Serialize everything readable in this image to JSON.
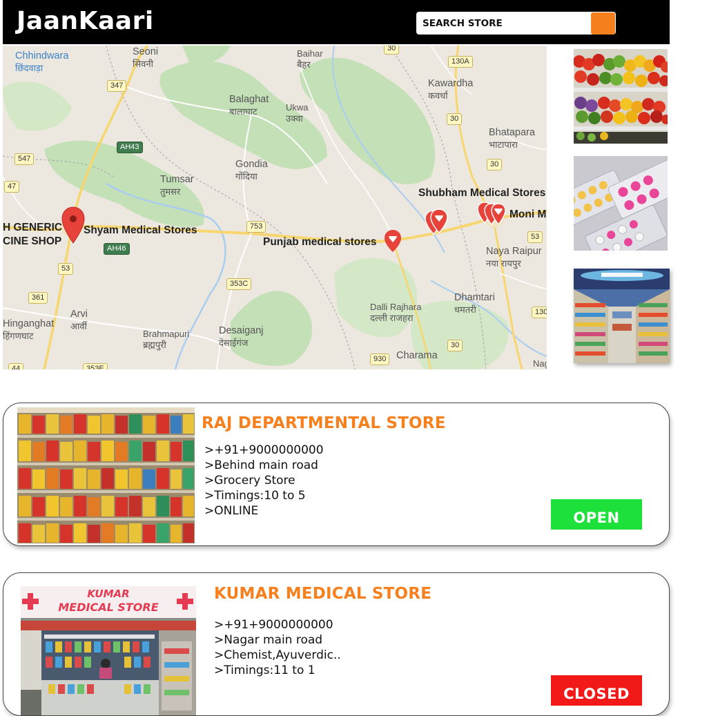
{
  "header": {
    "logo": "JaanKaari",
    "search_placeholder": "SEARCH STORE"
  },
  "map": {
    "places": [
      {
        "id": "chhindwara",
        "name": "Chhindwara",
        "local": "छिंदवाड़ा"
      },
      {
        "id": "seoni",
        "name": "Seoni",
        "local": "सिवनी"
      },
      {
        "id": "baihar",
        "name": "Baihar",
        "local": "बैहर"
      },
      {
        "id": "kawardha",
        "name": "Kawardha",
        "local": "कवर्धा"
      },
      {
        "id": "balaghat",
        "name": "Balaghat",
        "local": "बालाघाट"
      },
      {
        "id": "ukwa",
        "name": "Ukwa",
        "local": "उक्वा"
      },
      {
        "id": "bhatapara",
        "name": "Bhatapara",
        "local": "भाटापारा"
      },
      {
        "id": "gondia",
        "name": "Gondia",
        "local": "गोंदिया"
      },
      {
        "id": "tumsar",
        "name": "Tumsar",
        "local": "तुमसर"
      },
      {
        "id": "naya_raipur",
        "name": "Naya Raipur",
        "local": "नया रायपुर"
      },
      {
        "id": "dhamtari",
        "name": "Dhamtari",
        "local": "धमतरी"
      },
      {
        "id": "dalli_rajhara",
        "name": "Dalli Rajhara",
        "local": "दल्ली राजहरा"
      },
      {
        "id": "arvi",
        "name": "Arvi",
        "local": "आर्वी"
      },
      {
        "id": "hinganghat",
        "name": "Hinganghat",
        "local": "हिंगणघाट"
      },
      {
        "id": "brahmapuri",
        "name": "Brahmapuri",
        "local": "ब्रह्मपुरी"
      },
      {
        "id": "desaiganj",
        "name": "Desaiganj",
        "local": "देसाईगंज"
      },
      {
        "id": "charama",
        "name": "Charama",
        "local": ""
      },
      {
        "id": "nag",
        "name": "Nag",
        "local": ""
      }
    ],
    "stores": {
      "shubham": "Shubham Medical Stores",
      "moni": "Moni M",
      "shyam": "Shyam Medical Stores",
      "punjab": "Punjab medical stores",
      "generic_1": "H GENERIC",
      "generic_2": "CINE SHOP"
    },
    "shields": [
      "30",
      "130A",
      "347",
      "30",
      "AH43",
      "547",
      "30",
      "47",
      "753",
      "53",
      "AH46",
      "53",
      "353C",
      "361",
      "130",
      "30",
      "930",
      "44",
      "353E"
    ],
    "colors": {
      "land": "#ece8df",
      "forest": "#c3e0b6",
      "water": "#a9cdf0",
      "highway": "#f7d66f",
      "pin": "#e8433a"
    }
  },
  "thumbnails": [
    {
      "subject": "vegetable-shelves"
    },
    {
      "subject": "medicine-blister-packs"
    },
    {
      "subject": "supermarket-aisle"
    }
  ],
  "stores": [
    {
      "name": "RAJ DEPARTMENTAL STORE",
      "phone": ">+91+9000000000",
      "address": ">Behind main road",
      "category": ">Grocery Store",
      "timings": ">Timings:10 to 5",
      "extra": ">ONLINE",
      "status": "OPEN",
      "status_color": "#1ee03a"
    },
    {
      "name": "KUMAR MEDICAL STORE",
      "phone": ">+91+9000000000",
      "address": ">Nagar main road",
      "category": ">Chemist,Ayuverdic..",
      "timings": ">Timings:11 to 1",
      "status": "CLOSED",
      "status_color": "#f21919",
      "sign_line1": "KUMAR",
      "sign_line2": "MEDICAL STORE"
    }
  ],
  "accent_color": "#f7801e"
}
